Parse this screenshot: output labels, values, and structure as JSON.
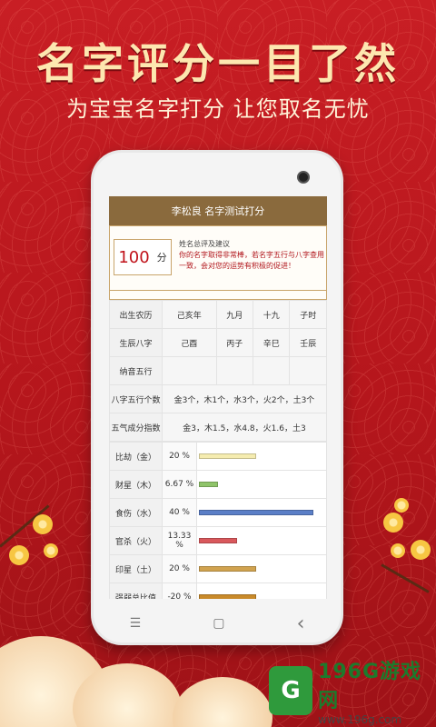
{
  "banner": {
    "headline": "名字评分一目了然",
    "subline": "为宝宝名字打分 让您取名无忧"
  },
  "app": {
    "title": "李松良 名字测试打分",
    "score": "100",
    "score_unit": "分",
    "summary_title": "姓名总评及建议",
    "summary_text": "你的名字取得非常棒，若名字五行与八字查用一致，会对您的运势有积极的促进！"
  },
  "table": {
    "birth_calendar": {
      "label": "出生农历",
      "cells": [
        "己亥年",
        "九月",
        "十九",
        "子时"
      ]
    },
    "bazi": {
      "label": "生辰八字",
      "cells": [
        "己酉",
        "丙子",
        "辛巳",
        "壬辰"
      ]
    },
    "nayin": {
      "label": "纳音五行",
      "cells": [
        "",
        "",
        "",
        ""
      ]
    },
    "wuxing_count": {
      "label": "八字五行个数",
      "value": "金3个，木1个，水3个，火2个，土3个"
    },
    "wuqi_index": {
      "label": "五气成分指数",
      "value": "金3，木1.5，水4.8，火1.6，土3"
    },
    "ratios": [
      {
        "label": "比劫（金）",
        "pct_text": "20 %",
        "pct": 20,
        "color": "#f5ecb0"
      },
      {
        "label": "财星（木）",
        "pct_text": "6.67 %",
        "pct": 6.67,
        "color": "#8fc46a"
      },
      {
        "label": "食伤（水）",
        "pct_text": "40 %",
        "pct": 40,
        "color": "#5b7fc7"
      },
      {
        "label": "官杀（火）",
        "pct_text": "13.33 %",
        "pct": 13.33,
        "color": "#d9585c"
      },
      {
        "label": "印星（土）",
        "pct_text": "20 %",
        "pct": 20,
        "color": "#d1a34f"
      },
      {
        "label": "强弱总比值",
        "pct_text": "-20 %",
        "pct": 20,
        "color": "#c98a2a"
      }
    ]
  },
  "nav": {
    "menu": "☰",
    "home": "▢",
    "back": "‹"
  },
  "watermark": {
    "name": "196G游戏网",
    "url": "www.196g.com",
    "mark": "G"
  }
}
